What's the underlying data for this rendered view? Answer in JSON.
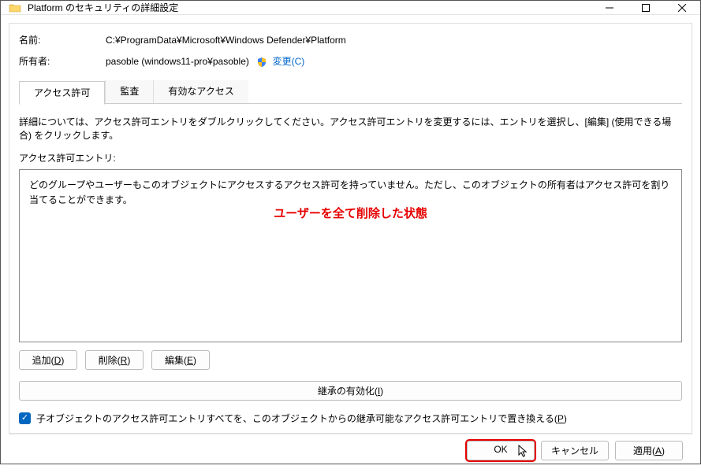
{
  "window": {
    "title": "Platform のセキュリティの詳細設定"
  },
  "info": {
    "name_label": "名前:",
    "name_value": "C:¥ProgramData¥Microsoft¥Windows Defender¥Platform",
    "owner_label": "所有者:",
    "owner_value": "pasoble (windows11-pro¥pasoble)",
    "change_link": "変更(C)"
  },
  "tabs": {
    "permissions": "アクセス許可",
    "audit": "監査",
    "effective": "有効なアクセス"
  },
  "instructions": "詳細については、アクセス許可エントリをダブルクリックしてください。アクセス許可エントリを変更するには、エントリを選択し、[編集] (使用できる場合) をクリックします。",
  "entries": {
    "label": "アクセス許可エントリ:",
    "empty_msg": "どのグループやユーザーもこのオブジェクトにアクセスするアクセス許可を持っていません。ただし、このオブジェクトの所有者はアクセス許可を割り当てることができます。",
    "annotation": "ユーザーを全て削除した状態"
  },
  "buttons": {
    "add": "追加(D)",
    "remove": "削除(R)",
    "edit": "編集(E)",
    "enable_inherit": "継承の有効化(I)",
    "ok": "OK",
    "cancel": "キャンセル",
    "apply": "適用(A)"
  },
  "checkbox": {
    "label_prefix": "子オブジェクトのアクセス許可エントリすべてを、このオブジェクトからの継承可能なアクセス許可エントリで置き換える(",
    "hotkey": "P",
    "label_suffix": ")"
  },
  "hotkeys": {
    "add": "D",
    "remove": "R",
    "edit": "E",
    "inherit": "I",
    "apply": "A",
    "change": "C"
  }
}
